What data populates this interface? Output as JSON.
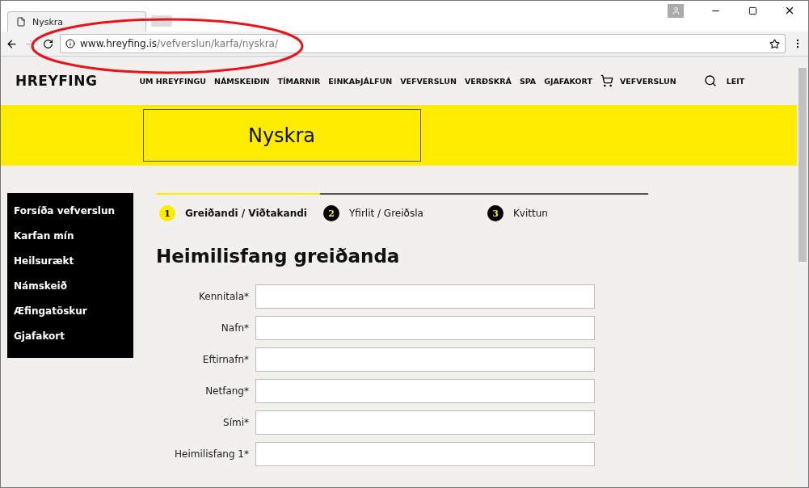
{
  "browser": {
    "tab_title": "Nyskra",
    "url_host": "www.hreyfing.is",
    "url_path": "/vefverslun/karfa/nyskra/"
  },
  "header": {
    "logo": "HREYFING",
    "nav": [
      "UM HREYFINGU",
      "NÁMSKEIÐIN",
      "TÍMARNIR",
      "EINKAÞJÁLFUN",
      "VEFVERSLUN",
      "VERÐSKRÁ",
      "SPA",
      "GJAFAKORT"
    ],
    "cart_label": "VEFVERSLUN",
    "search_label": "LEIT"
  },
  "banner": {
    "title": "Nyskra"
  },
  "sidebar": {
    "items": [
      "Forsíða vefverslun",
      "Karfan mín",
      "Heilsurækt",
      "Námskeið",
      "Æfingatöskur",
      "Gjafakort"
    ]
  },
  "steps": [
    {
      "number": "1",
      "label": "Greiðandi / Viðtakandi",
      "selected": true
    },
    {
      "number": "2",
      "label": "Yfirlit / Greiðsla",
      "selected": false
    },
    {
      "number": "3",
      "label": "Kvittun",
      "selected": false
    }
  ],
  "form": {
    "heading": "Heimilisfang greiðanda",
    "fields": [
      {
        "label": "Kennitala*"
      },
      {
        "label": "Nafn*"
      },
      {
        "label": "Eftirnafn*"
      },
      {
        "label": "Netfang*"
      },
      {
        "label": "Sími*"
      },
      {
        "label": "Heimilisfang 1*"
      }
    ]
  }
}
